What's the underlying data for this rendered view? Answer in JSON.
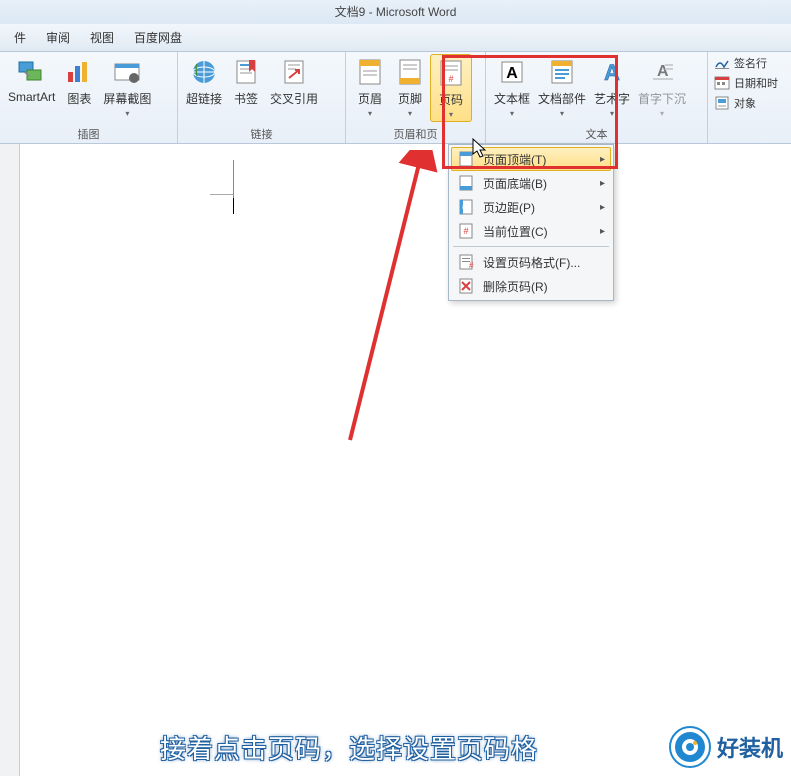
{
  "title": "文档9 - Microsoft Word",
  "tabs": {
    "t0": "件",
    "t1": "审阅",
    "t2": "视图",
    "t3": "百度网盘"
  },
  "ribbon": {
    "smartart": "SmartArt",
    "chart": "图表",
    "screenshot": "屏幕截图",
    "hyperlink": "超链接",
    "bookmark": "书签",
    "crossref": "交叉引用",
    "header": "页眉",
    "footer": "页脚",
    "pagenum": "页码",
    "textbox": "文本框",
    "docparts": "文档部件",
    "wordart": "艺术字",
    "dropcap": "首字下沉",
    "signature": "签名行",
    "datetime": "日期和时",
    "object": "对象"
  },
  "groups": {
    "illustrations": "插图",
    "links": "链接",
    "headerfooter": "页眉和页",
    "text": "文本"
  },
  "menu": {
    "top": "页面顶端(T)",
    "bottom": "页面底端(B)",
    "margins": "页边距(P)",
    "current": "当前位置(C)",
    "format": "设置页码格式(F)...",
    "remove": "删除页码(R)"
  },
  "caption": "接着点击页码，选择设置页码格",
  "watermark": "好装机",
  "colors": {
    "highlight": "#e03030",
    "accent": "#2088d0"
  }
}
